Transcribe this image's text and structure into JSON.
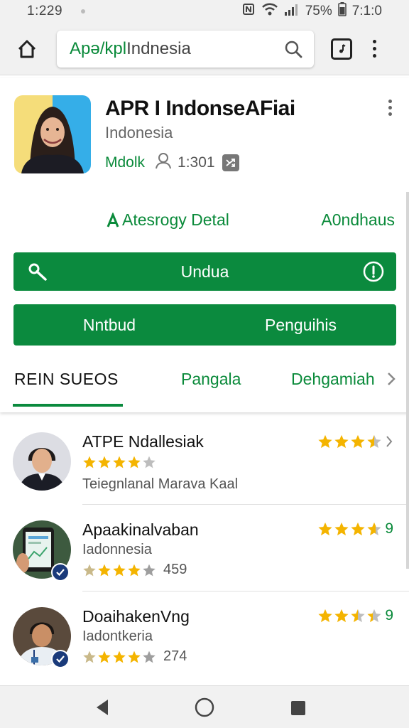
{
  "status_bar": {
    "time": "1:229",
    "battery": "75%",
    "right_time": "7:1:0"
  },
  "browser": {
    "url_host": "Apə/kpl",
    "url_path": " Indnesia"
  },
  "app": {
    "title": "APR I IndonseAFiai",
    "subtitle": "Indonesia",
    "developer": "Mdolk",
    "user_count": "1:301",
    "category_link": "Atesrogy Detal",
    "right_link": "A0ndhaus",
    "primary_button": "Undua",
    "button_left": "Nntbud",
    "button_right": "Penguihis"
  },
  "tabs": [
    "REIN SUEOS",
    "Pangala",
    "Dehgamiah"
  ],
  "list": [
    {
      "title": "ATPE Ndallesiak",
      "line2": "",
      "line3_text": "Teiegnlanal Marava Kaal",
      "rating": 4,
      "rating_label": "",
      "inline_stars": 4,
      "inline_count": "",
      "verified": false
    },
    {
      "title": "Apaakinalvaban",
      "line2": "Iadonnesia",
      "line3_text": "",
      "rating": 4,
      "rating_label": "9",
      "inline_stars": 4,
      "inline_count": "459",
      "verified": true
    },
    {
      "title": "DoaihakenVng",
      "line2": "Iadontkeria",
      "line3_text": "",
      "rating": 3.5,
      "rating_label": "9",
      "inline_stars": 4,
      "inline_count": "274",
      "verified": true
    }
  ],
  "colors": {
    "accent": "#0b8a3e",
    "star": "#f4b400",
    "star_empty": "#bdbdbd"
  }
}
